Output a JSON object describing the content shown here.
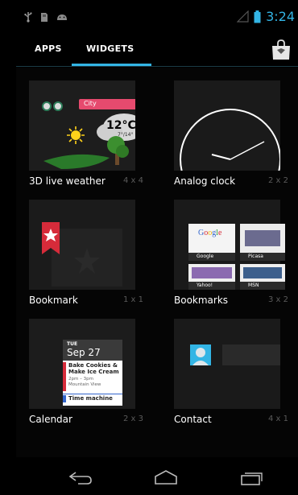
{
  "status_bar": {
    "time": "3:24",
    "left_icons": [
      "usb-icon",
      "sd-card-icon",
      "android-icon"
    ],
    "right_icons": [
      "signal-icon",
      "battery-icon"
    ]
  },
  "tabs": [
    {
      "label": "APPS",
      "selected": false
    },
    {
      "label": "WIDGETS",
      "selected": true
    }
  ],
  "store_button": {
    "icon": "play-store-bag-icon"
  },
  "widgets": [
    {
      "name": "3D live weather",
      "size": "4 x 4",
      "preview": {
        "city": "City",
        "temperature": "12°C",
        "temp_range": "7°/14°"
      }
    },
    {
      "name": "Analog clock",
      "size": "2 x 2"
    },
    {
      "name": "Bookmark",
      "size": "1 x 1"
    },
    {
      "name": "Bookmarks",
      "size": "3 x 2",
      "preview": {
        "tiles": [
          "Google",
          "Picasa",
          "Yahoo!",
          "MSN"
        ]
      }
    },
    {
      "name": "Calendar",
      "size": "2 x 3",
      "preview": {
        "weekday": "TUE",
        "date": "Sep 27",
        "event_title": "Bake Cookies & Make Ice Cream",
        "event_time": "2pm – 3pm",
        "event_location": "Mountain View",
        "next_event": "Time machine"
      }
    },
    {
      "name": "Contact",
      "size": "4 x 1"
    }
  ],
  "nav_bar": [
    "back-icon",
    "home-icon",
    "recents-icon"
  ],
  "colors": {
    "accent": "#33b5e5",
    "background": "#050505",
    "card": "#1a1a1a"
  }
}
